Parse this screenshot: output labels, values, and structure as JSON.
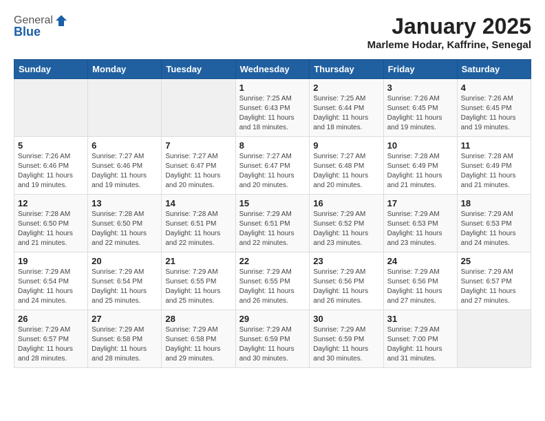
{
  "logo": {
    "general": "General",
    "blue": "Blue"
  },
  "header": {
    "month": "January 2025",
    "location": "Marleme Hodar, Kaffrine, Senegal"
  },
  "days_of_week": [
    "Sunday",
    "Monday",
    "Tuesday",
    "Wednesday",
    "Thursday",
    "Friday",
    "Saturday"
  ],
  "weeks": [
    [
      {
        "day": "",
        "info": ""
      },
      {
        "day": "",
        "info": ""
      },
      {
        "day": "",
        "info": ""
      },
      {
        "day": "1",
        "info": "Sunrise: 7:25 AM\nSunset: 6:43 PM\nDaylight: 11 hours and 18 minutes."
      },
      {
        "day": "2",
        "info": "Sunrise: 7:25 AM\nSunset: 6:44 PM\nDaylight: 11 hours and 18 minutes."
      },
      {
        "day": "3",
        "info": "Sunrise: 7:26 AM\nSunset: 6:45 PM\nDaylight: 11 hours and 19 minutes."
      },
      {
        "day": "4",
        "info": "Sunrise: 7:26 AM\nSunset: 6:45 PM\nDaylight: 11 hours and 19 minutes."
      }
    ],
    [
      {
        "day": "5",
        "info": "Sunrise: 7:26 AM\nSunset: 6:46 PM\nDaylight: 11 hours and 19 minutes."
      },
      {
        "day": "6",
        "info": "Sunrise: 7:27 AM\nSunset: 6:46 PM\nDaylight: 11 hours and 19 minutes."
      },
      {
        "day": "7",
        "info": "Sunrise: 7:27 AM\nSunset: 6:47 PM\nDaylight: 11 hours and 20 minutes."
      },
      {
        "day": "8",
        "info": "Sunrise: 7:27 AM\nSunset: 6:47 PM\nDaylight: 11 hours and 20 minutes."
      },
      {
        "day": "9",
        "info": "Sunrise: 7:27 AM\nSunset: 6:48 PM\nDaylight: 11 hours and 20 minutes."
      },
      {
        "day": "10",
        "info": "Sunrise: 7:28 AM\nSunset: 6:49 PM\nDaylight: 11 hours and 21 minutes."
      },
      {
        "day": "11",
        "info": "Sunrise: 7:28 AM\nSunset: 6:49 PM\nDaylight: 11 hours and 21 minutes."
      }
    ],
    [
      {
        "day": "12",
        "info": "Sunrise: 7:28 AM\nSunset: 6:50 PM\nDaylight: 11 hours and 21 minutes."
      },
      {
        "day": "13",
        "info": "Sunrise: 7:28 AM\nSunset: 6:50 PM\nDaylight: 11 hours and 22 minutes."
      },
      {
        "day": "14",
        "info": "Sunrise: 7:28 AM\nSunset: 6:51 PM\nDaylight: 11 hours and 22 minutes."
      },
      {
        "day": "15",
        "info": "Sunrise: 7:29 AM\nSunset: 6:51 PM\nDaylight: 11 hours and 22 minutes."
      },
      {
        "day": "16",
        "info": "Sunrise: 7:29 AM\nSunset: 6:52 PM\nDaylight: 11 hours and 23 minutes."
      },
      {
        "day": "17",
        "info": "Sunrise: 7:29 AM\nSunset: 6:53 PM\nDaylight: 11 hours and 23 minutes."
      },
      {
        "day": "18",
        "info": "Sunrise: 7:29 AM\nSunset: 6:53 PM\nDaylight: 11 hours and 24 minutes."
      }
    ],
    [
      {
        "day": "19",
        "info": "Sunrise: 7:29 AM\nSunset: 6:54 PM\nDaylight: 11 hours and 24 minutes."
      },
      {
        "day": "20",
        "info": "Sunrise: 7:29 AM\nSunset: 6:54 PM\nDaylight: 11 hours and 25 minutes."
      },
      {
        "day": "21",
        "info": "Sunrise: 7:29 AM\nSunset: 6:55 PM\nDaylight: 11 hours and 25 minutes."
      },
      {
        "day": "22",
        "info": "Sunrise: 7:29 AM\nSunset: 6:55 PM\nDaylight: 11 hours and 26 minutes."
      },
      {
        "day": "23",
        "info": "Sunrise: 7:29 AM\nSunset: 6:56 PM\nDaylight: 11 hours and 26 minutes."
      },
      {
        "day": "24",
        "info": "Sunrise: 7:29 AM\nSunset: 6:56 PM\nDaylight: 11 hours and 27 minutes."
      },
      {
        "day": "25",
        "info": "Sunrise: 7:29 AM\nSunset: 6:57 PM\nDaylight: 11 hours and 27 minutes."
      }
    ],
    [
      {
        "day": "26",
        "info": "Sunrise: 7:29 AM\nSunset: 6:57 PM\nDaylight: 11 hours and 28 minutes."
      },
      {
        "day": "27",
        "info": "Sunrise: 7:29 AM\nSunset: 6:58 PM\nDaylight: 11 hours and 28 minutes."
      },
      {
        "day": "28",
        "info": "Sunrise: 7:29 AM\nSunset: 6:58 PM\nDaylight: 11 hours and 29 minutes."
      },
      {
        "day": "29",
        "info": "Sunrise: 7:29 AM\nSunset: 6:59 PM\nDaylight: 11 hours and 30 minutes."
      },
      {
        "day": "30",
        "info": "Sunrise: 7:29 AM\nSunset: 6:59 PM\nDaylight: 11 hours and 30 minutes."
      },
      {
        "day": "31",
        "info": "Sunrise: 7:29 AM\nSunset: 7:00 PM\nDaylight: 11 hours and 31 minutes."
      },
      {
        "day": "",
        "info": ""
      }
    ]
  ]
}
